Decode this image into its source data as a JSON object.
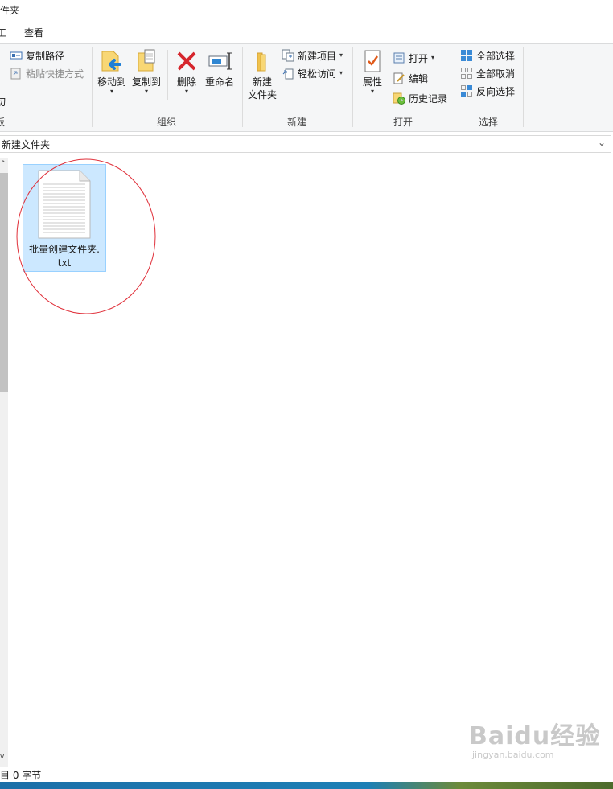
{
  "window": {
    "title": "件夹"
  },
  "menu": {
    "tab_left": "工",
    "tab_view": "查看"
  },
  "ribbon": {
    "clipboard": {
      "copy_path": "复制路径",
      "paste_shortcut": "粘贴快捷方式",
      "cut_partial": "切",
      "label_partial": "板"
    },
    "organize": {
      "label": "组织",
      "move_to": "移动到",
      "copy_to": "复制到",
      "delete": "删除",
      "rename": "重命名"
    },
    "new": {
      "label": "新建",
      "new_folder_line1": "新建",
      "new_folder_line2": "文件夹",
      "new_item": "新建项目",
      "easy_access": "轻松访问"
    },
    "open": {
      "label": "打开",
      "properties": "属性",
      "open": "打开",
      "edit": "编辑",
      "history": "历史记录"
    },
    "select": {
      "label": "选择",
      "select_all": "全部选择",
      "select_none": "全部取消",
      "invert": "反向选择"
    }
  },
  "address": {
    "path": "新建文件夹"
  },
  "file": {
    "name_line1": "批量创建文件夹.",
    "name_line2": "txt"
  },
  "status": {
    "text": "目  0 字节"
  },
  "watermark": {
    "brand": "Baidu经验",
    "url": "jingyan.baidu.com"
  }
}
